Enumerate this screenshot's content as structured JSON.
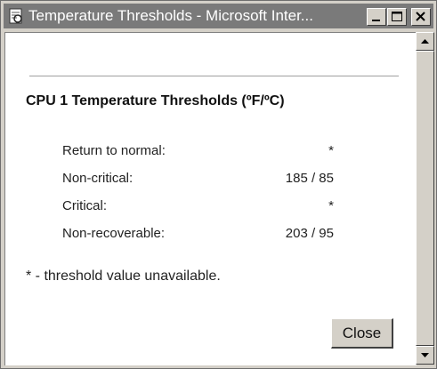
{
  "window": {
    "title": "Temperature Thresholds - Microsoft Inter...",
    "icons": {
      "app": "ie-page-icon",
      "minimize": "minimize-icon",
      "maximize": "maximize-icon",
      "close": "close-icon"
    }
  },
  "dialog": {
    "heading": "CPU 1 Temperature Thresholds (ºF/ºC)",
    "thresholds": [
      {
        "label": "Return to normal:",
        "value": "*"
      },
      {
        "label": "Non-critical:",
        "value": "185 / 85"
      },
      {
        "label": "Critical:",
        "value": "*"
      },
      {
        "label": "Non-recoverable:",
        "value": "203 / 95"
      }
    ],
    "footnote": "* - threshold value unavailable.",
    "close_label": "Close"
  },
  "scrollbar": {
    "icons": {
      "up": "scroll-up-arrow-icon",
      "down": "scroll-down-arrow-icon"
    }
  }
}
